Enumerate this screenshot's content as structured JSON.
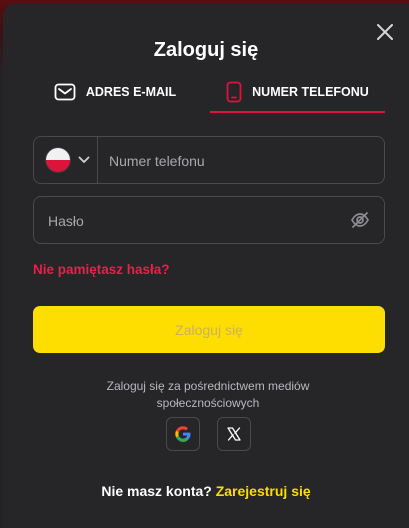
{
  "modal": {
    "title": "Zaloguj się",
    "tabs": [
      {
        "label": "ADRES E-MAIL",
        "icon": "envelope-icon"
      },
      {
        "label": "NUMER TELEFONU",
        "icon": "phone-icon",
        "active": true
      }
    ],
    "phone": {
      "country_icon": "poland-flag-icon",
      "placeholder": "Numer telefonu"
    },
    "password": {
      "placeholder": "Hasło",
      "icon": "eye-slash-icon"
    },
    "forgot": "Nie pamiętasz hasła?",
    "submit": "Zaloguj się",
    "social_text": "Zaloguj się za pośrednictwem mediów społecznościowych",
    "social": [
      "google-icon",
      "x-icon"
    ],
    "register_question": "Nie masz konta?",
    "register_link": "Zarejestruj się"
  },
  "colors": {
    "accent": "#e0123c",
    "yellow": "#fede00",
    "background": "#262528"
  }
}
